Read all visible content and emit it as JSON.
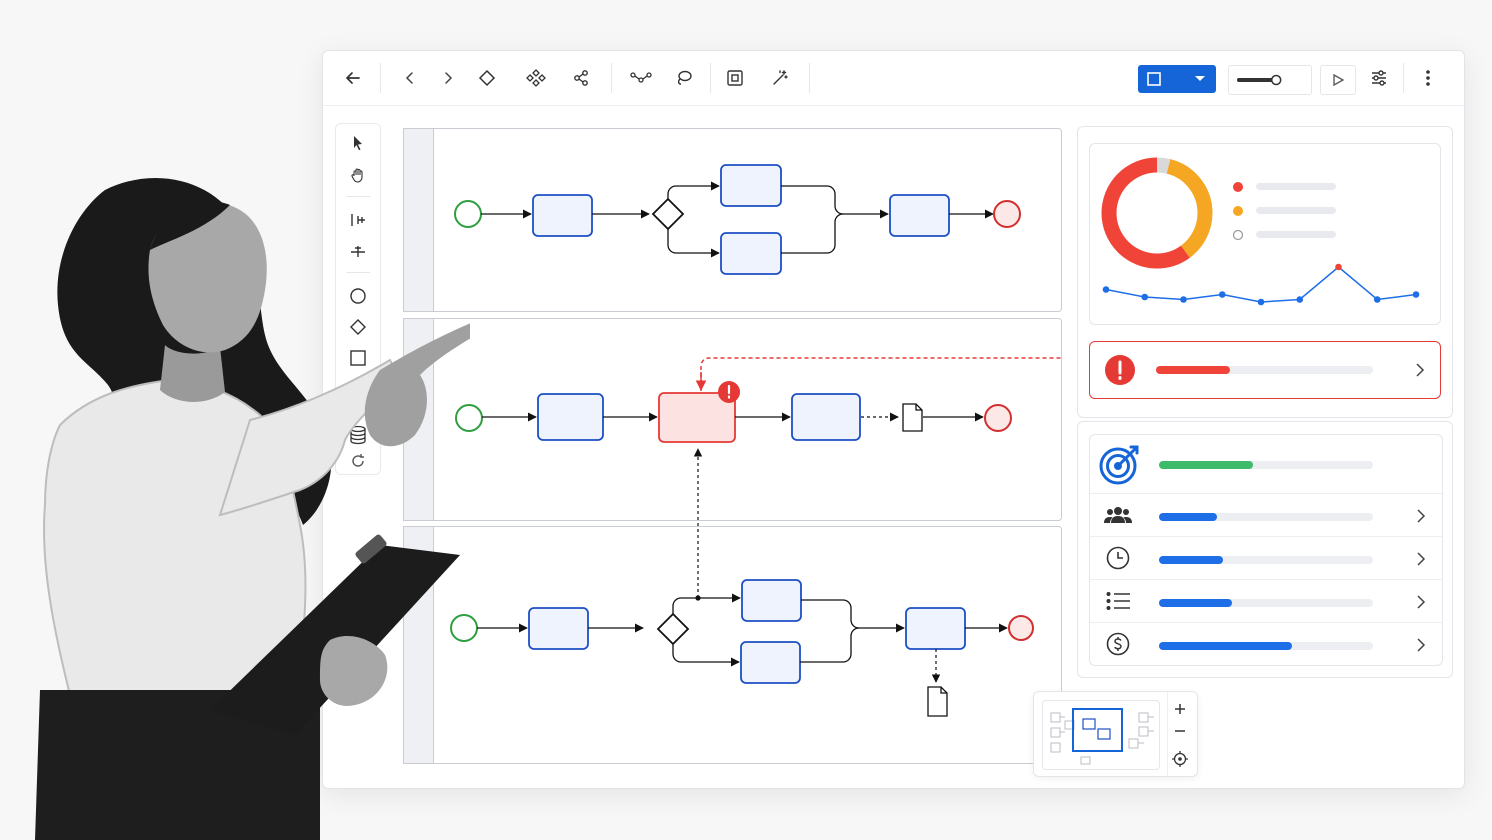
{
  "toolbar": {
    "back_icon": "arrow-left-icon",
    "undo_icon": "chevron-left-icon",
    "redo_icon": "chevron-right-icon",
    "tools": [
      "diamond-icon",
      "nodes-cluster-icon",
      "share-nodes-icon",
      "connect-icon",
      "lasso-icon",
      "fit-frame-icon",
      "magic-wand-icon"
    ],
    "mode_icon": "square-icon",
    "zoom_level": 0.7,
    "play_icon": "play-icon",
    "settings_icon": "sliders-icon",
    "more_icon": "kebab-icon",
    "accent": "#1565d8"
  },
  "palette": {
    "items": [
      "pointer-icon",
      "hand-icon",
      "split-horizontal-icon",
      "split-vertical-icon",
      "circle-event-icon",
      "diamond-gateway-icon",
      "square-task-icon",
      "dashed-frame-icon",
      "database-icon",
      "loop-icon"
    ]
  },
  "diagram": {
    "lanes": 3,
    "colors": {
      "start": "#2e9e3e",
      "end": "#d32f2f",
      "task": "#1d4fc4",
      "task_fill": "#eef3fd",
      "error": "#e53935",
      "error_fill": "#fde2e2"
    }
  },
  "dashboard": {
    "donut": [
      {
        "color": "#f04438",
        "value": 0.6
      },
      {
        "color": "#f5a623",
        "value": 0.36
      },
      {
        "color": "#d9d9d9",
        "value": 0.04
      }
    ],
    "sparkline": [
      0.45,
      0.3,
      0.25,
      0.35,
      0.2,
      0.25,
      0.9,
      0.25,
      0.35
    ],
    "alert": {
      "icon": "exclamation-icon",
      "progress": 0.34
    },
    "goal": {
      "icon": "target-icon",
      "progress": 0.44
    },
    "metrics": [
      {
        "icon": "users-icon",
        "progress": 0.27
      },
      {
        "icon": "clock-icon",
        "progress": 0.3
      },
      {
        "icon": "list-icon",
        "progress": 0.34
      },
      {
        "icon": "dollar-icon",
        "progress": 0.62
      }
    ]
  },
  "minimap": {
    "zoom_in_icon": "plus-icon",
    "zoom_out_icon": "minus-icon",
    "recenter_icon": "target-crosshair-icon"
  }
}
